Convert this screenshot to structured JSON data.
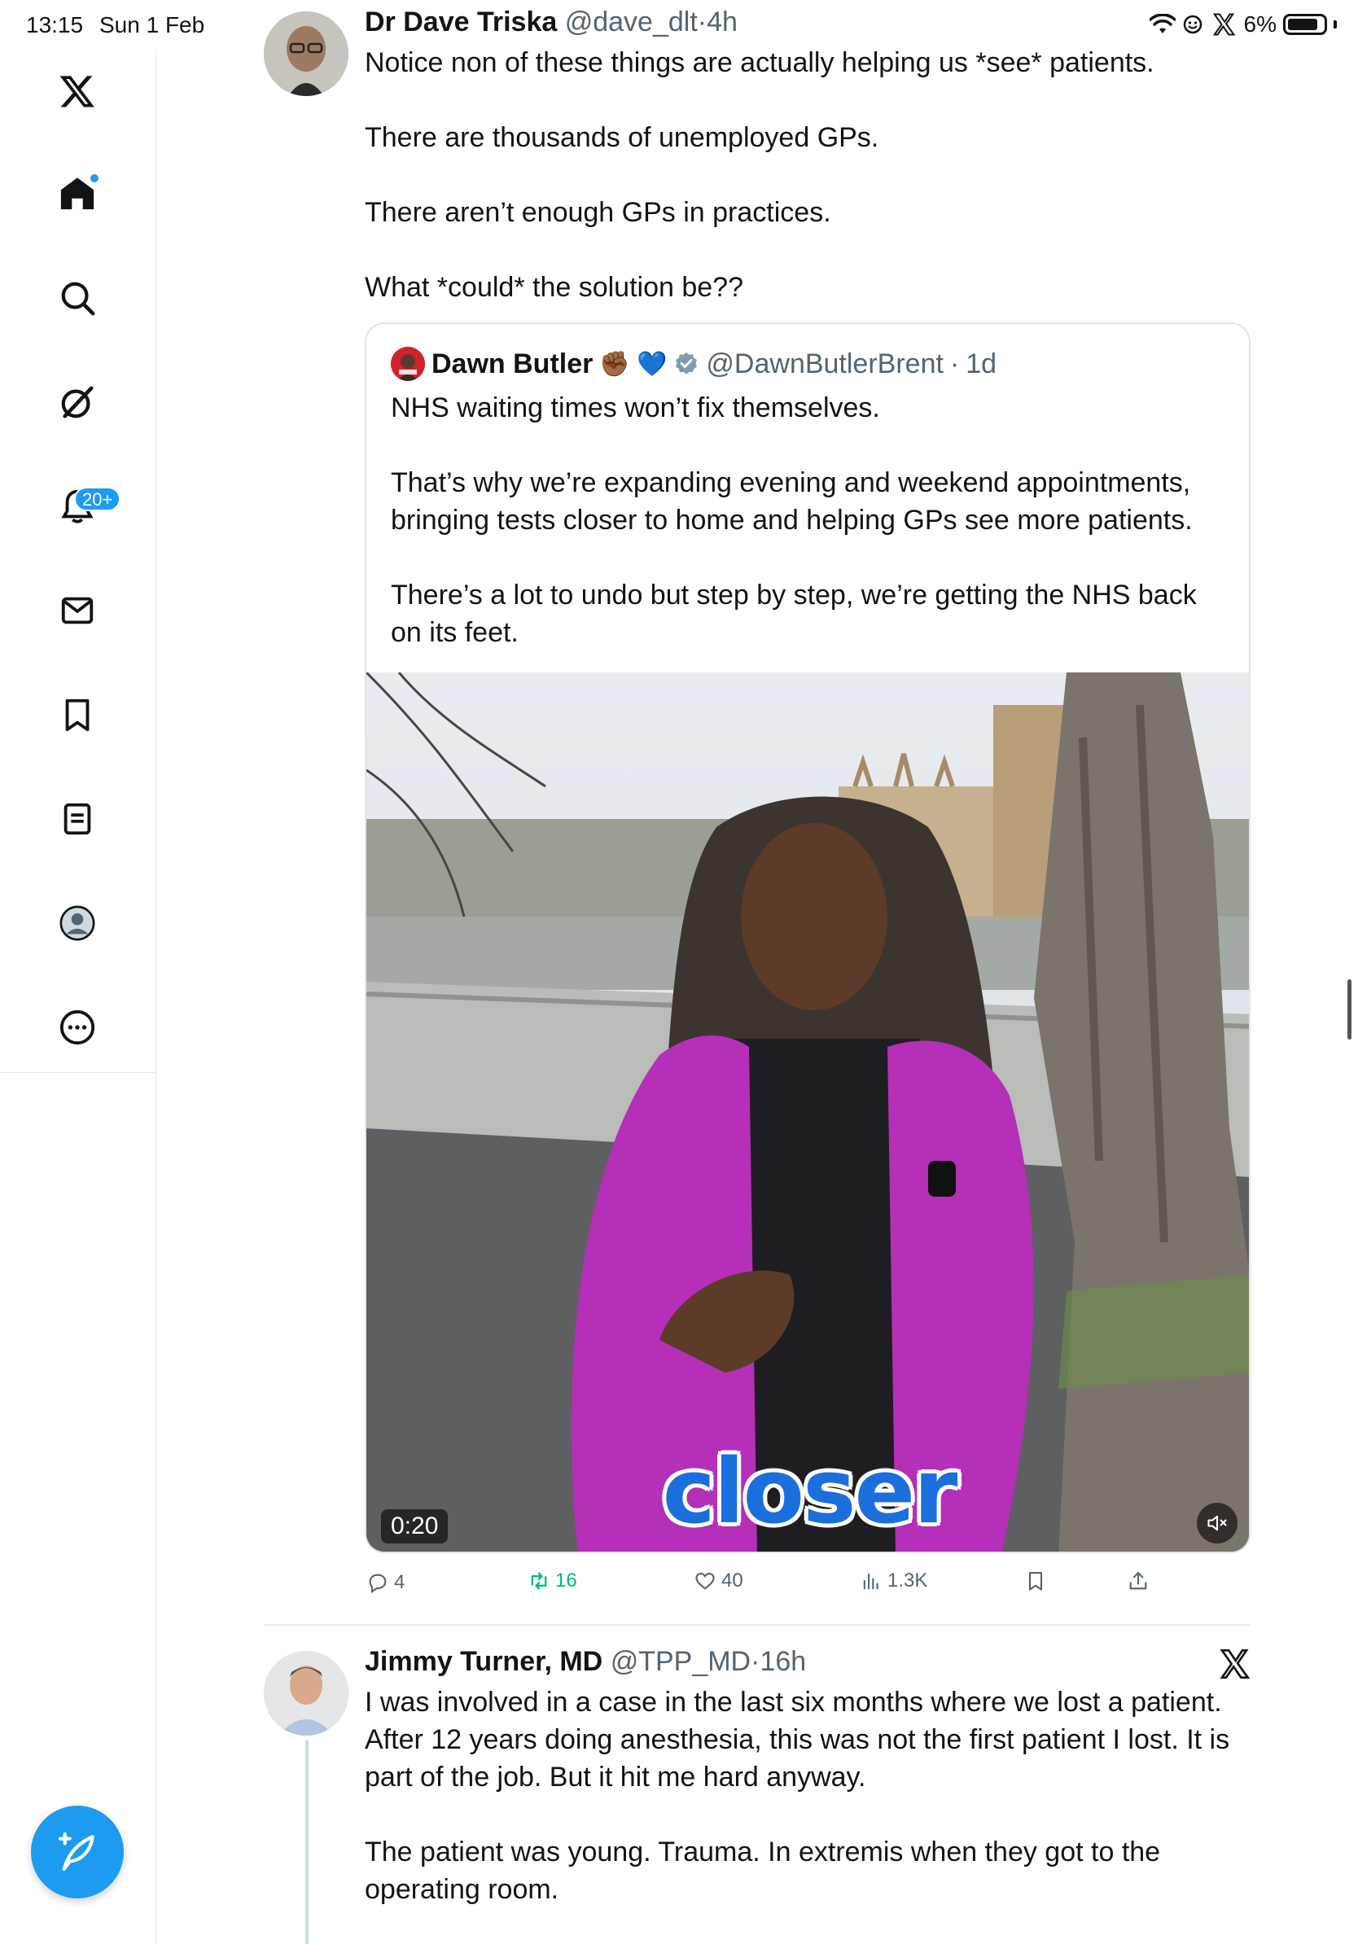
{
  "status_bar": {
    "time": "13:15",
    "date": "Sun 1 Feb",
    "battery": "6%"
  },
  "sidebar": {
    "items": [
      {
        "name": "x-logo-icon"
      },
      {
        "name": "home-icon"
      },
      {
        "name": "search-icon"
      },
      {
        "name": "grok-icon"
      },
      {
        "name": "notifications-icon",
        "badge": "20+"
      },
      {
        "name": "messages-icon"
      },
      {
        "name": "bookmarks-icon"
      },
      {
        "name": "lists-icon"
      },
      {
        "name": "profile-icon"
      },
      {
        "name": "more-icon"
      }
    ]
  },
  "tweet1": {
    "author": "Dr Dave Triska",
    "handle": "@dave_dlt",
    "dot": "·",
    "time": "4h",
    "paragraphs": [
      "Notice non of these things are actually helping us *see* patients.",
      "There are thousands of unemployed GPs.",
      "There aren’t enough GPs in practices.",
      "What *could* the solution be??"
    ],
    "quote": {
      "author": "Dawn Butler",
      "emoji": "✊🏾 💙",
      "handle": "@DawnButlerBrent",
      "dot": "·",
      "time": "1d",
      "paragraphs": [
        "NHS waiting times won’t fix themselves.",
        "That’s why we’re expanding evening and weekend appointments, bringing tests closer to home and helping GPs see more patients.",
        "There’s a lot to undo but step by step, we’re getting the NHS back on its feet."
      ],
      "video": {
        "duration": "0:20",
        "caption": "closer"
      }
    },
    "actions": {
      "replies": "4",
      "reposts": "16",
      "likes": "40",
      "views": "1.3K"
    }
  },
  "tweet2": {
    "author": "Jimmy Turner, MD",
    "handle": "@TPP_MD",
    "dot": "·",
    "time": "16h",
    "paragraphs": [
      "I was involved in a case in the last six months where we lost a patient. After 12 years doing anesthesia, this was not the first patient I lost. It is part of the job. But it hit me hard anyway.",
      "The patient was young. Trauma. In extremis when they got to the operating room."
    ]
  },
  "colors": {
    "accent": "#1d9bf0",
    "repost_active": "#00ba7c",
    "secondary_text": "#536471"
  }
}
